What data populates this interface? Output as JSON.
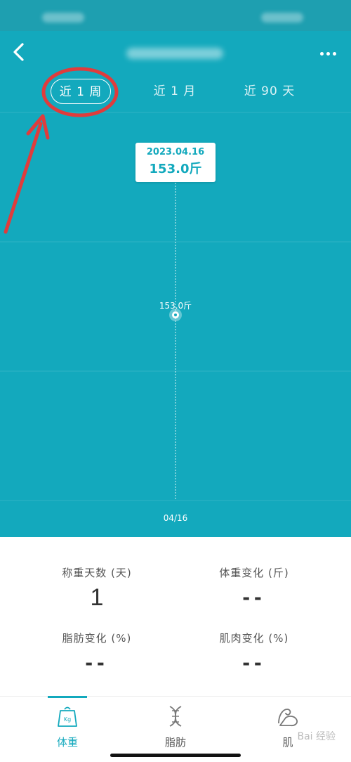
{
  "tabs": [
    {
      "label": "近 1 周",
      "active": true
    },
    {
      "label": "近 1 月",
      "active": false
    },
    {
      "label": "近 90 天",
      "active": false
    }
  ],
  "chart_data": {
    "type": "scatter",
    "x": [
      "04/16"
    ],
    "values": [
      153.0
    ],
    "point_label": "153.0斤",
    "tooltip_date": "2023.04.16",
    "tooltip_value": "153.0斤",
    "grid": true
  },
  "stats": {
    "days_label": "称重天数 (天)",
    "days_value": "1",
    "weight_change_label": "体重变化 (斤)",
    "weight_change_value": "--",
    "fat_change_label": "脂肪变化 (%)",
    "fat_change_value": "--",
    "muscle_change_label": "肌肉变化 (%)",
    "muscle_change_value": "--"
  },
  "nav": {
    "weight": "体重",
    "fat": "脂肪",
    "muscle_partial": "肌"
  },
  "colors": {
    "accent": "#13a9bd",
    "annotation": "#e03c3c"
  },
  "icons": {
    "back": "back-arrow-icon",
    "more": "more-dots-icon",
    "weight": "kg-weight-icon",
    "fat": "dna-icon",
    "muscle": "muscle-arm-icon"
  },
  "watermark": "Bai 经验"
}
